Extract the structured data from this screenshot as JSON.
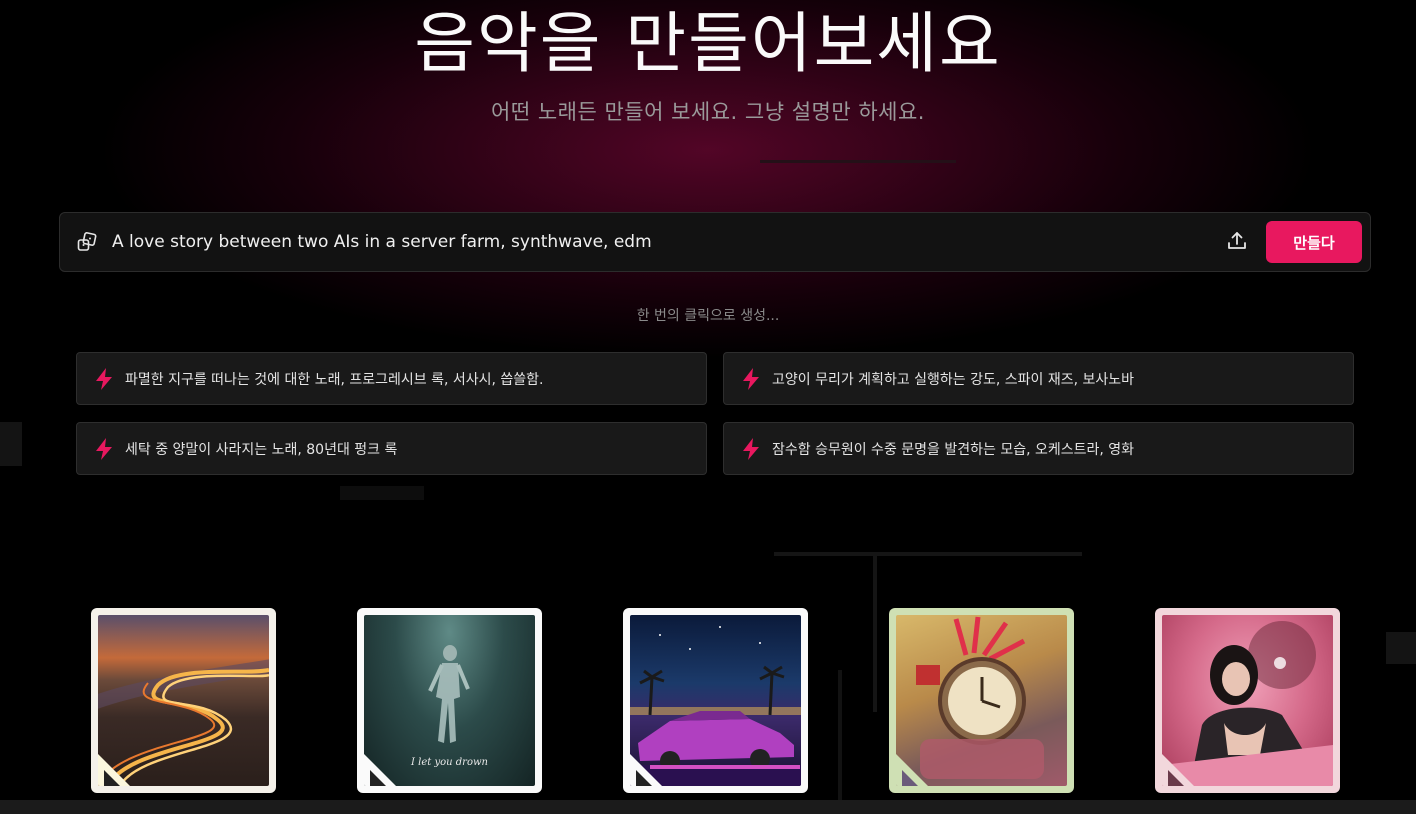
{
  "hero": {
    "title": "음악을 만들어보세요",
    "subtitle": "어떤 노래든 만들어 보세요. 그냥 설명만 하세요."
  },
  "prompt": {
    "value": "A love story between two AIs in a server farm, synthwave, edm",
    "icon": "dice-icon",
    "upload_icon": "upload-icon",
    "create_label": "만들다"
  },
  "hint": "한 번의 클릭으로 생성...",
  "suggestions": [
    {
      "text": "파멸한 지구를 떠나는 것에 대한 노래, 프로그레시브 록, 서사시, 씁쓸함."
    },
    {
      "text": "고양이 무리가 계획하고 실행하는 강도, 스파이 재즈, 보사노바"
    },
    {
      "text": "세탁 중 양말이 사라지는 노래, 80년대 펑크 록"
    },
    {
      "text": "잠수함 승무원이 수중 문명을 발견하는 모습, 오케스트라, 영화"
    }
  ],
  "cards": [
    {
      "art": "winding-road-sunset"
    },
    {
      "art": "underwater-figure",
      "caption": "I let you drown"
    },
    {
      "art": "neon-car-palm-trees"
    },
    {
      "art": "alarm-clock-collage"
    },
    {
      "art": "pink-devil-portrait"
    }
  ],
  "colors": {
    "accent": "#e8185f",
    "background": "#000000",
    "panel": "#121212"
  }
}
